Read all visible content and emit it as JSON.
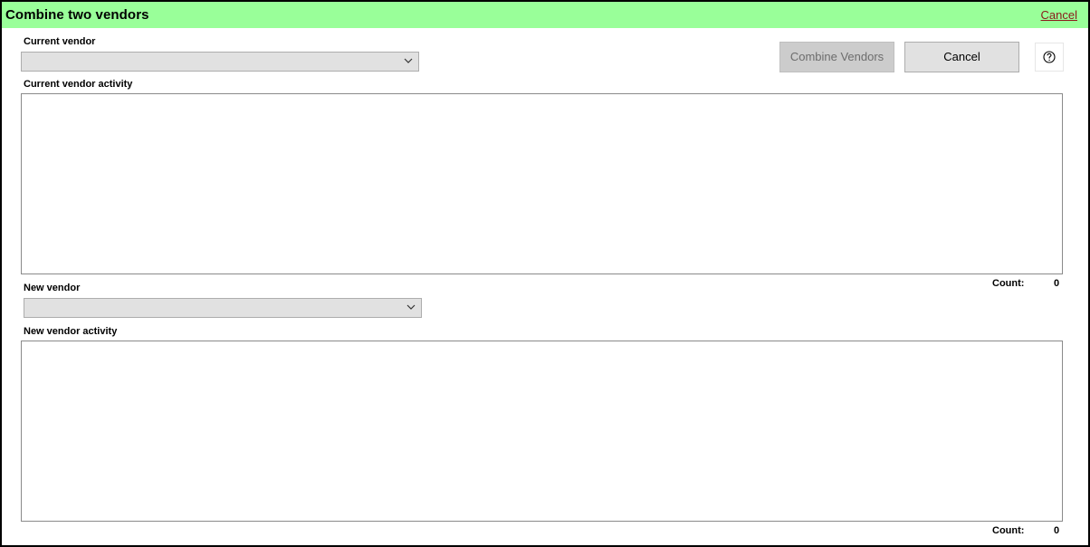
{
  "dialog": {
    "title": "Combine two vendors",
    "title_cancel_link": "Cancel"
  },
  "current_vendor": {
    "label": "Current vendor",
    "selected": "",
    "activity_label": "Current vendor activity",
    "count_label": "Count:",
    "count_value": "0"
  },
  "new_vendor": {
    "label": "New vendor",
    "selected": "",
    "activity_label": "New vendor activity",
    "count_label": "Count:",
    "count_value": "0"
  },
  "buttons": {
    "combine": "Combine Vendors",
    "cancel": "Cancel"
  },
  "icons": {
    "help": "help-circle-icon",
    "dropdown": "chevron-down-icon"
  },
  "colors": {
    "titlebar": "#99ff99",
    "cancel_link": "#8b1a1a"
  }
}
